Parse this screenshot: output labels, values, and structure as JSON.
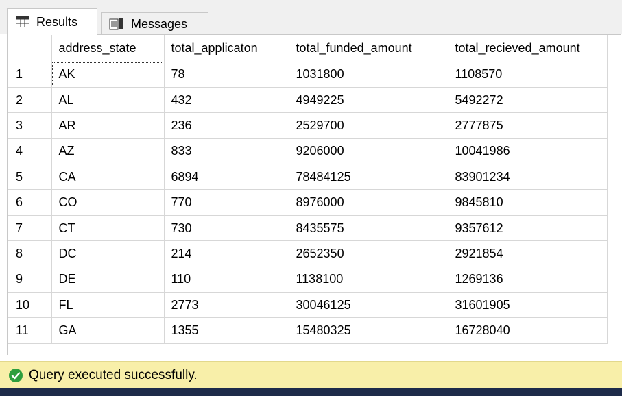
{
  "tabs": {
    "results_label": "Results",
    "messages_label": "Messages"
  },
  "grid": {
    "columns": [
      "",
      "address_state",
      "total_applicaton",
      "total_funded_amount",
      "total_recieved_amount"
    ],
    "rows": [
      [
        "1",
        "AK",
        "78",
        "1031800",
        "1108570"
      ],
      [
        "2",
        "AL",
        "432",
        "4949225",
        "5492272"
      ],
      [
        "3",
        "AR",
        "236",
        "2529700",
        "2777875"
      ],
      [
        "4",
        "AZ",
        "833",
        "9206000",
        "10041986"
      ],
      [
        "5",
        "CA",
        "6894",
        "78484125",
        "83901234"
      ],
      [
        "6",
        "CO",
        "770",
        "8976000",
        "9845810"
      ],
      [
        "7",
        "CT",
        "730",
        "8435575",
        "9357612"
      ],
      [
        "8",
        "DC",
        "214",
        "2652350",
        "2921854"
      ],
      [
        "9",
        "DE",
        "110",
        "1138100",
        "1269136"
      ],
      [
        "10",
        "FL",
        "2773",
        "30046125",
        "31601905"
      ],
      [
        "11",
        "GA",
        "1355",
        "15480325",
        "16728040"
      ]
    ]
  },
  "status": {
    "message": "Query executed successfully.",
    "icon": "check-circle-icon",
    "color": "#2e9e3e"
  },
  "colors": {
    "status_bg": "#f8efa9",
    "bottom_strip": "#1e2b4a"
  }
}
